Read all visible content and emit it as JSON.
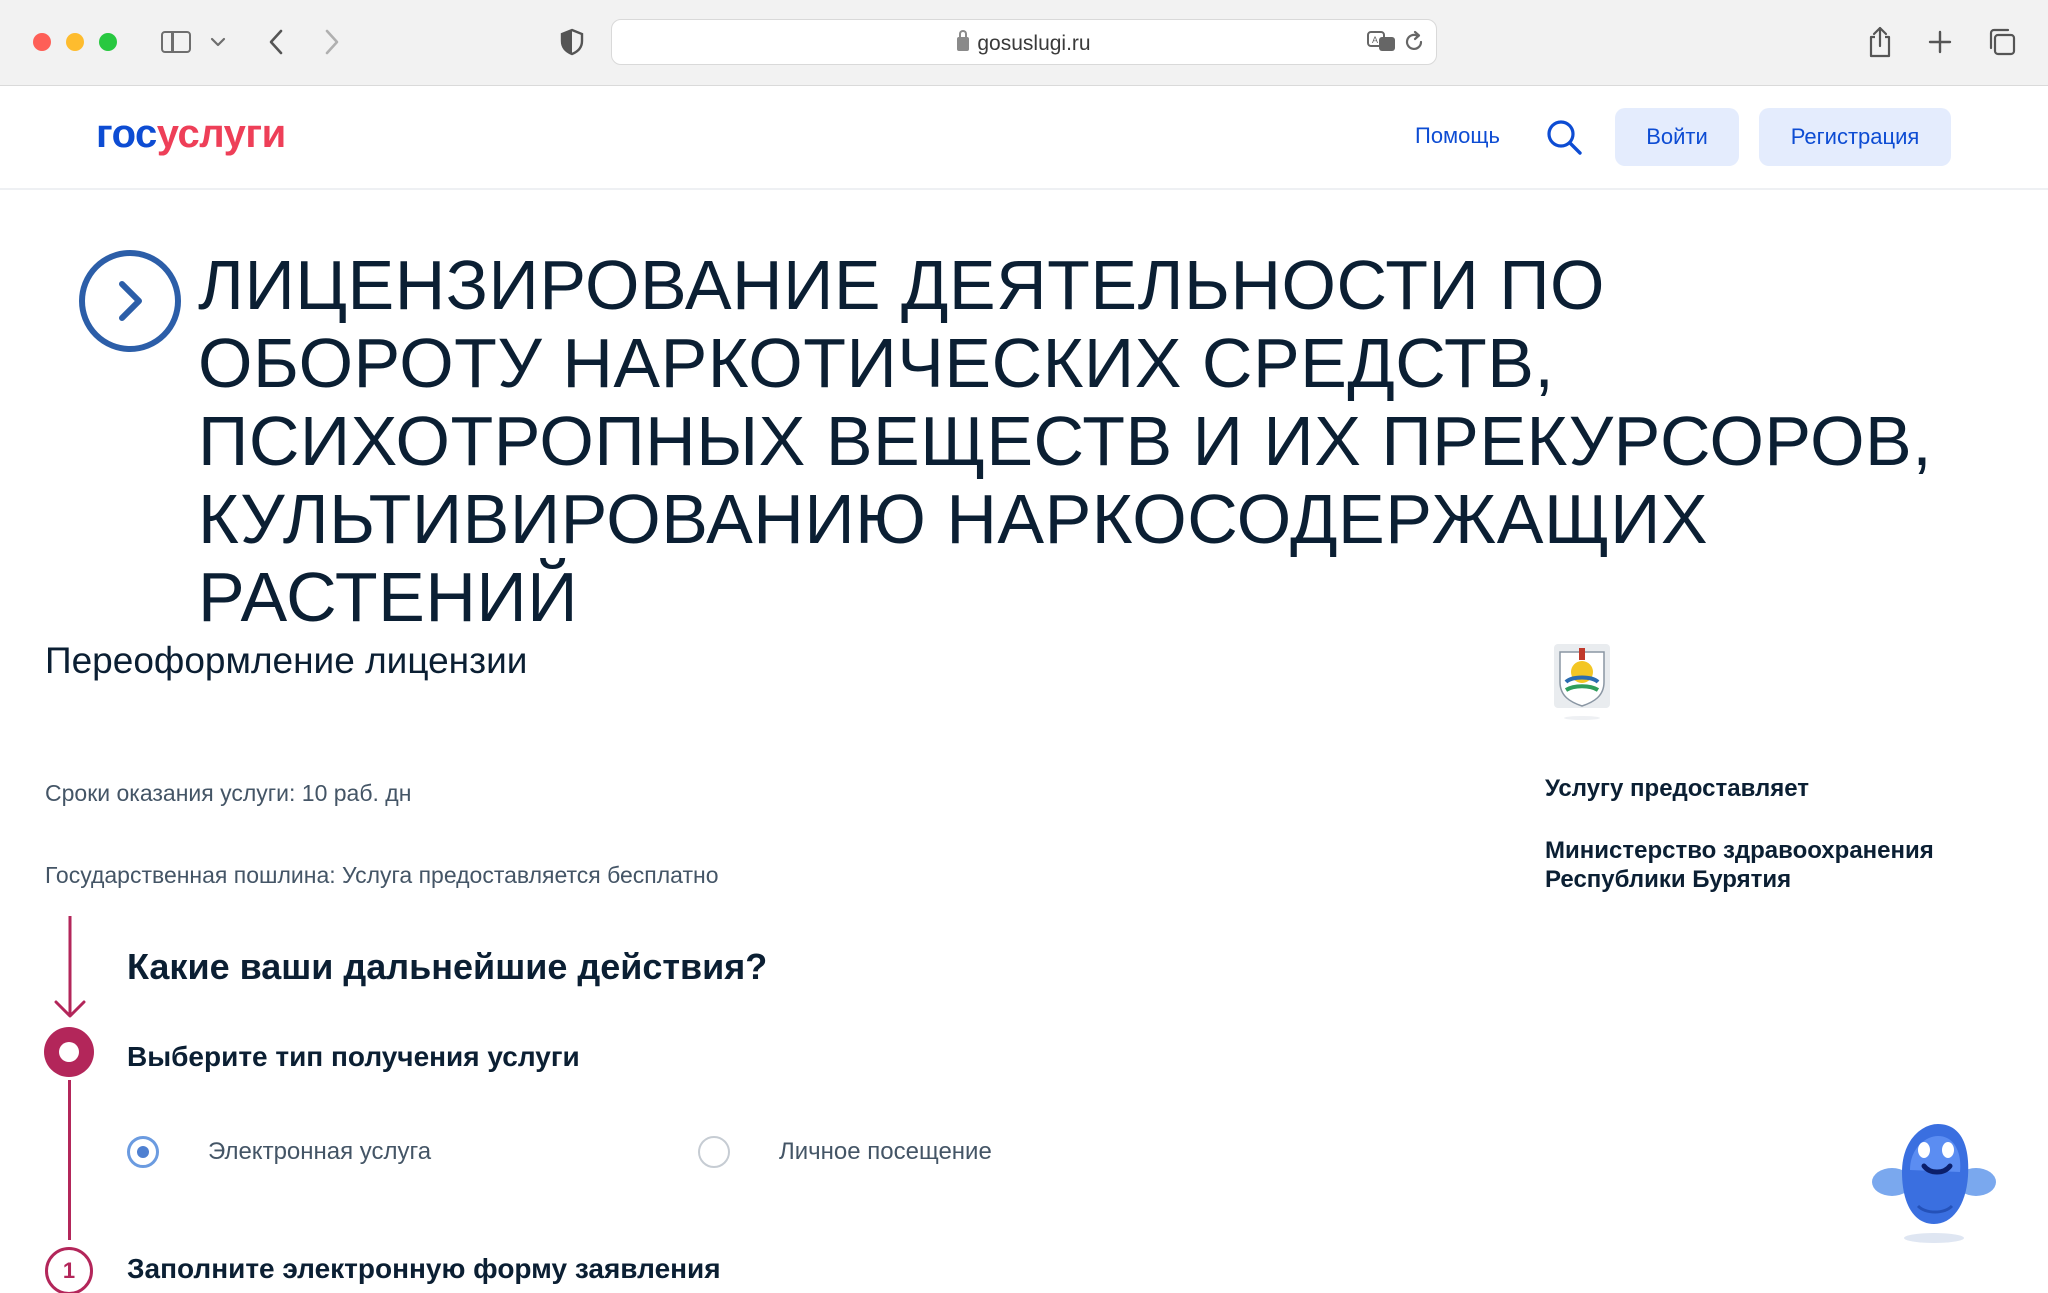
{
  "browser": {
    "url": "gosuslugi.ru"
  },
  "header": {
    "logo_part1": "гос",
    "logo_part2": "услуги",
    "help": "Помощь",
    "login": "Войти",
    "register": "Регистрация"
  },
  "page": {
    "title": "ЛИЦЕНЗИРОВАНИЕ ДЕЯТЕЛЬНОСТИ ПО ОБОРОТУ НАРКОТИЧЕСКИХ СРЕДСТВ, ПСИХОТРОПНЫХ ВЕЩЕСТВ И ИХ ПРЕКУРСОРОВ, КУЛЬТИВИРОВАНИЮ НАРКОСОДЕРЖАЩИХ РАСТЕНИЙ",
    "subtitle": "Переоформление лицензии",
    "term": "Сроки оказания услуги: 10 раб. дн",
    "fee": "Государственная пошлина: Услуга предоставляется бесплатно"
  },
  "steps": {
    "question": "Какие ваши дальнейшие действия?",
    "step1_title": "Выберите тип получения услуги",
    "options": [
      {
        "label": "Электронная услуга",
        "selected": true
      },
      {
        "label": "Личное посещение",
        "selected": false
      }
    ],
    "step2_number": "1",
    "step2_title": "Заполните электронную форму заявления"
  },
  "provider": {
    "heading": "Услугу предоставляет",
    "name": "Министерство здравоохранения Республики Бурятия"
  },
  "colors": {
    "brand_blue": "#0d4cd3",
    "brand_red": "#ee3f58",
    "step_accent": "#b3265a",
    "button_bg": "#e4ecfd"
  }
}
